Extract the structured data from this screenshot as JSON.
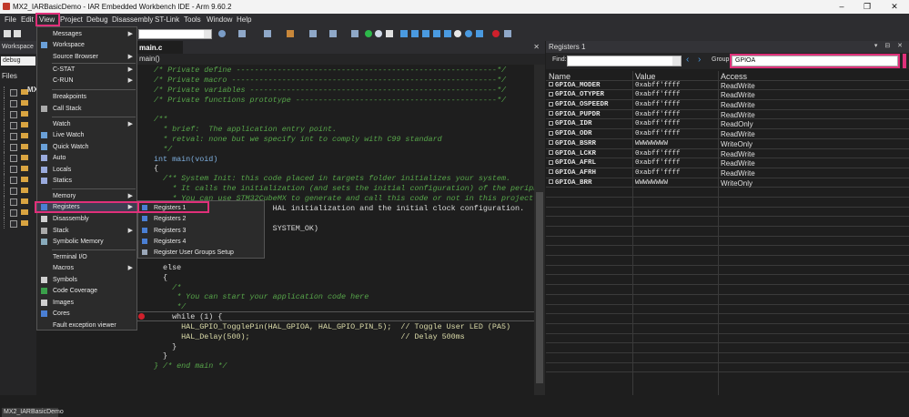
{
  "window": {
    "title": "MX2_IARBasicDemo - IAR Embedded Workbench IDE - Arm 9.60.2",
    "min": "–",
    "max": "❐",
    "close": "✕"
  },
  "menubar": [
    "File",
    "Edit",
    "View",
    "Project",
    "Debug",
    "Disassembly",
    "ST-Link",
    "Tools",
    "Window",
    "Help"
  ],
  "workspace": {
    "header": "Workspace",
    "config": "debug",
    "files_label": "Files",
    "project": "MX2",
    "footer_tab": "MX2_IARBasicDemo"
  },
  "view_menu": {
    "items": [
      {
        "label": "Messages",
        "arrow": "▶"
      },
      {
        "label": "Workspace",
        "arrow": ""
      },
      {
        "label": "Source Browser",
        "arrow": "▶"
      },
      {
        "label": "C-STAT",
        "arrow": "▶"
      },
      {
        "label": "C-RUN",
        "arrow": "▶"
      },
      {
        "label": "Breakpoints",
        "arrow": ""
      },
      {
        "label": "Call Stack",
        "arrow": ""
      },
      {
        "label": "Watch",
        "arrow": "▶"
      },
      {
        "label": "Live Watch",
        "arrow": ""
      },
      {
        "label": "Quick Watch",
        "arrow": ""
      },
      {
        "label": "Auto",
        "arrow": ""
      },
      {
        "label": "Locals",
        "arrow": ""
      },
      {
        "label": "Statics",
        "arrow": ""
      },
      {
        "label": "Memory",
        "arrow": "▶"
      },
      {
        "label": "Registers",
        "arrow": "▶"
      },
      {
        "label": "Disassembly",
        "arrow": ""
      },
      {
        "label": "Stack",
        "arrow": "▶"
      },
      {
        "label": "Symbolic Memory",
        "arrow": ""
      },
      {
        "label": "Terminal I/O",
        "arrow": ""
      },
      {
        "label": "Macros",
        "arrow": "▶"
      },
      {
        "label": "Symbols",
        "arrow": ""
      },
      {
        "label": "Code Coverage",
        "arrow": ""
      },
      {
        "label": "Images",
        "arrow": ""
      },
      {
        "label": "Cores",
        "arrow": ""
      },
      {
        "label": "Fault exception viewer",
        "arrow": ""
      }
    ]
  },
  "registers_submenu": [
    "Registers 1",
    "Registers 2",
    "Registers 3",
    "Registers 4",
    "Register User Groups Setup"
  ],
  "editor": {
    "tab": "main.c",
    "close": "✕",
    "function": "main()",
    "lines": [
      "/* Private define ---------------------------------------------------------*/",
      "/* Private macro ----------------------------------------------------------*/",
      "/* Private variables ------------------------------------------------------*/",
      "/* Private functions prototype --------------------------------------------*/",
      "",
      "/**",
      "  * brief:  The application entry point.",
      "  * retval: none but we specify int to comply with C99 standard",
      "  */",
      "int main(void)",
      "{",
      "  /** System Init: this code placed in targets folder initializes your system.",
      "    * It calls the initialization (and sets the initial configuration) of the peripherals.",
      "    * You can use STM32CubeMX to generate and call this code or not in this project.",
      "                          HAL initialization and the initial clock configuration.",
      "",
      "                          SYSTEM_OK)",
      "",
      "",
      "",
      "  else",
      "  {",
      "    /*",
      "     * You can start your application code here",
      "     */",
      "    while (1) {",
      "      HAL_GPIO_TogglePin(HAL_GPIOA, HAL_GPIO_PIN_5);  // Toggle User LED (PA5)",
      "      HAL_Delay(500);                                 // Delay 500ms",
      "    }",
      "  }",
      "} /* end main */"
    ]
  },
  "registers_panel": {
    "title": "Registers 1",
    "find_label": "Find:",
    "group_label": "Group:",
    "group_value": "GPIOA",
    "columns": [
      "Name",
      "Value",
      "Access"
    ],
    "rows": [
      {
        "name": "GPIOA_MODER",
        "value": "0xabff'ffff",
        "access": "ReadWrite"
      },
      {
        "name": "GPIOA_OTYPER",
        "value": "0xabff'ffff",
        "access": "ReadWrite"
      },
      {
        "name": "GPIOA_OSPEEDR",
        "value": "0xabff'ffff",
        "access": "ReadWrite"
      },
      {
        "name": "GPIOA_PUPDR",
        "value": "0xabff'ffff",
        "access": "ReadWrite"
      },
      {
        "name": "GPIOA_IDR",
        "value": "0xabff'ffff",
        "access": "ReadOnly"
      },
      {
        "name": "GPIOA_ODR",
        "value": "0xabff'ffff",
        "access": "ReadWrite"
      },
      {
        "name": "GPIOA_BSRR",
        "value": "WWWWWWWW",
        "access": "WriteOnly"
      },
      {
        "name": "GPIOA_LCKR",
        "value": "0xabff'ffff",
        "access": "ReadWrite"
      },
      {
        "name": "GPIOA_AFRL",
        "value": "0xabff'ffff",
        "access": "ReadWrite"
      },
      {
        "name": "GPIOA_AFRH",
        "value": "0xabff'ffff",
        "access": "ReadWrite"
      },
      {
        "name": "GPIOA_BRR",
        "value": "WWWWWWWW",
        "access": "WriteOnly"
      }
    ]
  },
  "colors": {
    "highlight": "#e0307a",
    "accent": "#4a9ae0",
    "breakpoint": "#d0202c"
  }
}
